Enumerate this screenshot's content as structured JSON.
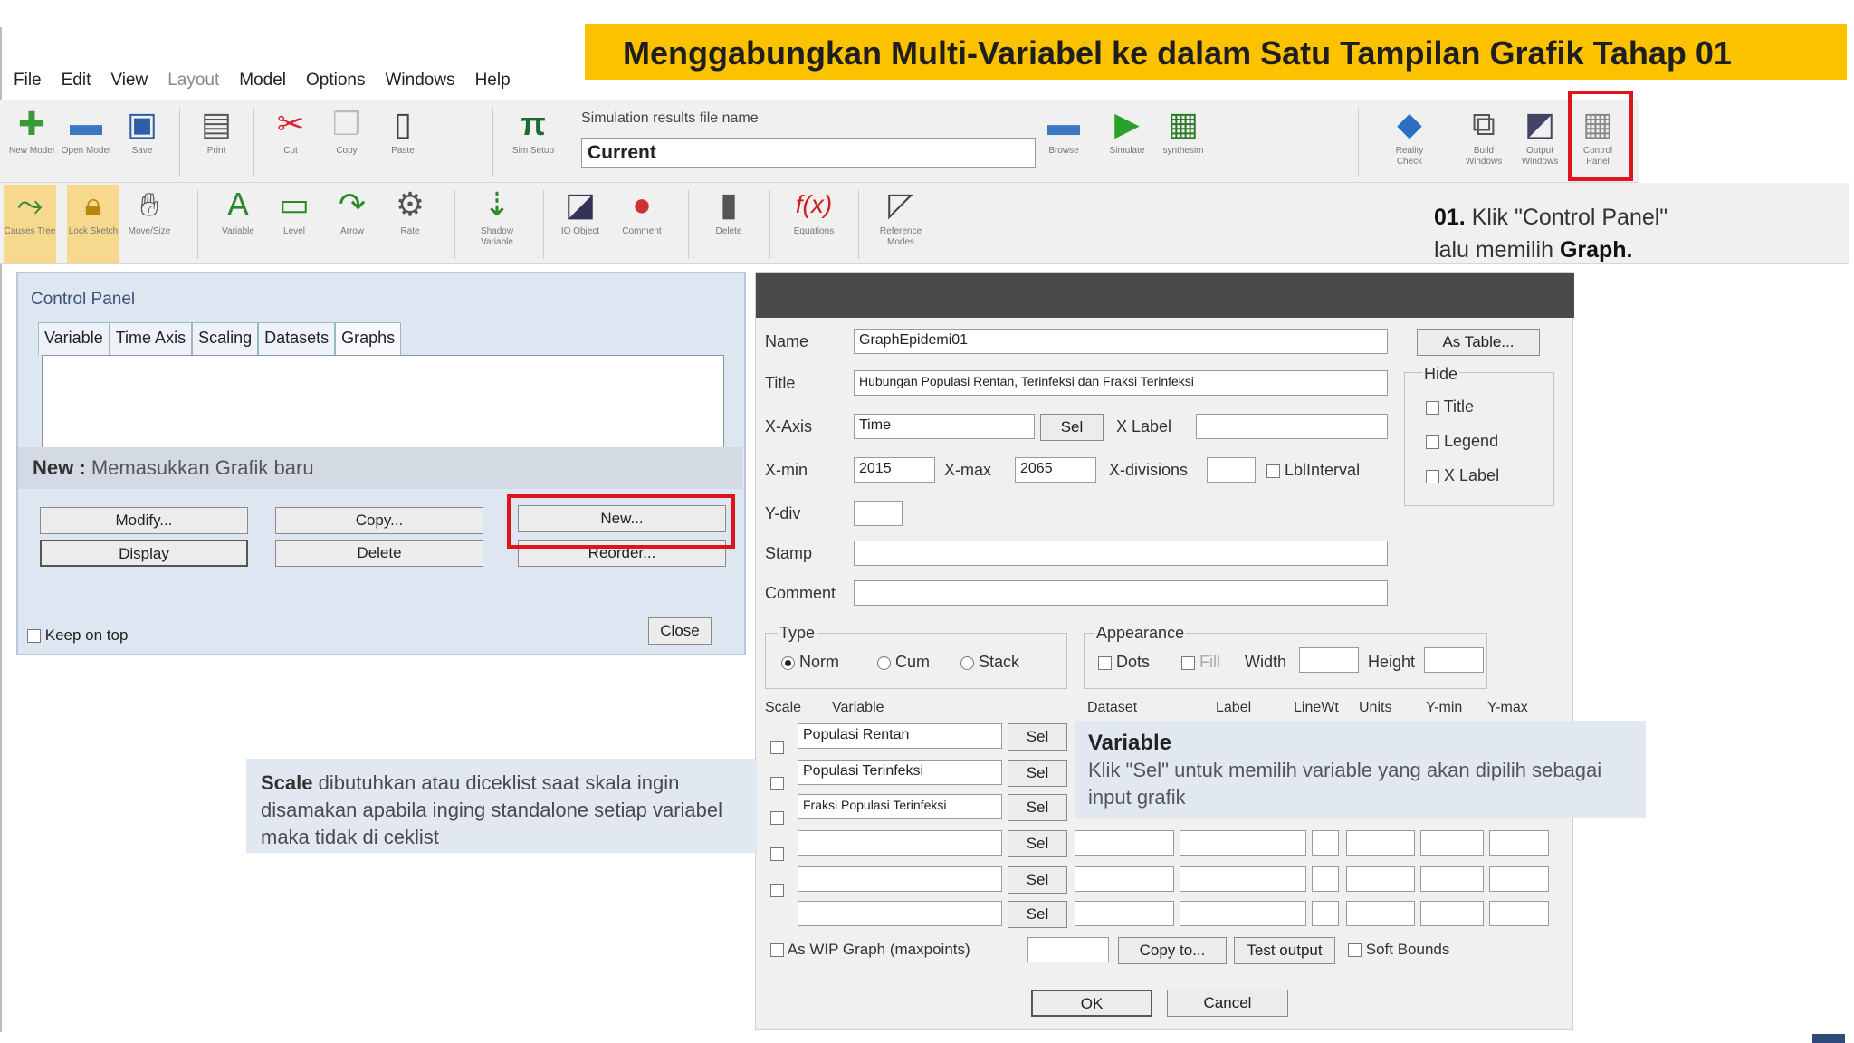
{
  "banner": {
    "title": "Menggabungkan Multi-Variabel ke dalam Satu Tampilan Grafik Tahap 01"
  },
  "menu": [
    "File",
    "Edit",
    "View",
    "Layout",
    "Model",
    "Options",
    "Windows",
    "Help"
  ],
  "toolbar1": {
    "buttons": [
      "New Model",
      "Open Model",
      "Save",
      "Print",
      "Cut",
      "Copy",
      "Paste",
      "Sim Setup"
    ],
    "sim_label": "Simulation results file name",
    "sim_value": "Current",
    "run_buttons": [
      "Browse",
      "Simulate",
      "synthesim"
    ],
    "right_buttons": [
      "Reality Check",
      "Build Windows",
      "Output Windows",
      "Control Panel"
    ]
  },
  "toolbar2": {
    "buttons": [
      "Causes Tree",
      "Lock Sketch",
      "Move/Size",
      "Variable",
      "Level",
      "Arrow",
      "Rate",
      "Shadow Variable",
      "IO Object",
      "Comment",
      "Delete",
      "Equations",
      "Reference Modes"
    ]
  },
  "step": {
    "num": "01.",
    "text1": "Klik \"Control Panel\"",
    "text2": "lalu memilih",
    "text3": "Graph."
  },
  "control_panel": {
    "title": "Control Panel",
    "tabs": [
      "Variable",
      "Time Axis",
      "Scaling",
      "Datasets",
      "Graphs"
    ],
    "new_hint_bold": "New :",
    "new_hint": "Memasukkan Grafik baru",
    "buttons": {
      "modify": "Modify...",
      "copy": "Copy...",
      "new": "New...",
      "display": "Display",
      "delete": "Delete",
      "reorder": "Reorder..."
    },
    "keep_on_top": "Keep on top",
    "close": "Close"
  },
  "dialog": {
    "name_label": "Name",
    "name_value": "GraphEpidemi01",
    "as_table": "As Table...",
    "title_label": "Title",
    "title_value": "Hubungan Populasi Rentan, Terinfeksi dan Fraksi Terinfeksi",
    "hide_label": "Hide",
    "hide_items": [
      "Title",
      "Legend",
      "X Label"
    ],
    "xaxis_label": "X-Axis",
    "xaxis_value": "Time",
    "sel": "Sel",
    "xlabel_label": "X Label",
    "xmin_label": "X-min",
    "xmin_value": "2015",
    "xmax_label": "X-max",
    "xmax_value": "2065",
    "xdiv_label": "X-divisions",
    "lblinterval": "LblInterval",
    "ydiv_label": "Y-div",
    "stamp_label": "Stamp",
    "comment_label": "Comment",
    "type_label": "Type",
    "type_options": [
      "Norm",
      "Cum",
      "Stack"
    ],
    "appearance_label": "Appearance",
    "appearance": {
      "dots": "Dots",
      "fill": "Fill",
      "width": "Width",
      "height": "Height"
    },
    "col_headers": {
      "scale": "Scale",
      "variable": "Variable",
      "dataset": "Dataset",
      "label": "Label",
      "linewt": "LineWt",
      "units": "Units",
      "ymin": "Y-min",
      "ymax": "Y-max"
    },
    "variables": [
      "Populasi Rentan",
      "Populasi Terinfeksi",
      "Fraksi Populasi Terinfeksi",
      "",
      "",
      ""
    ],
    "wip": "As WIP Graph (maxpoints)",
    "copy_to": "Copy to...",
    "test_output": "Test output",
    "soft_bounds": "Soft Bounds",
    "ok": "OK",
    "cancel": "Cancel"
  },
  "scale_note": {
    "bold": "Scale",
    "text": "dibutuhkan atau diceklist saat skala ingin disamakan apabila inging standalone setiap variabel maka tidak di ceklist"
  },
  "variable_note": {
    "title": "Variable",
    "text": "Klik \"Sel\" untuk memilih variable yang akan dipilih sebagai input grafik"
  },
  "colors": {
    "banner": "#fcc200",
    "highlight": "#e0141c",
    "callout": "#e2e8f1"
  }
}
